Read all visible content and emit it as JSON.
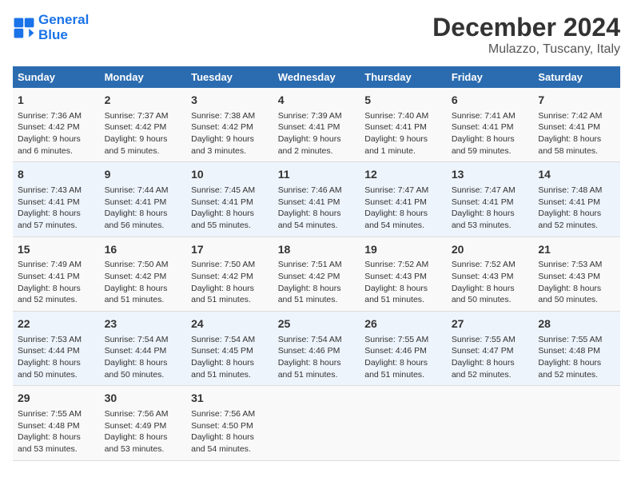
{
  "logo": {
    "line1": "General",
    "line2": "Blue"
  },
  "title": "December 2024",
  "subtitle": "Mulazzo, Tuscany, Italy",
  "headers": [
    "Sunday",
    "Monday",
    "Tuesday",
    "Wednesday",
    "Thursday",
    "Friday",
    "Saturday"
  ],
  "weeks": [
    [
      {
        "day": "1",
        "info": "Sunrise: 7:36 AM\nSunset: 4:42 PM\nDaylight: 9 hours\nand 6 minutes."
      },
      {
        "day": "2",
        "info": "Sunrise: 7:37 AM\nSunset: 4:42 PM\nDaylight: 9 hours\nand 5 minutes."
      },
      {
        "day": "3",
        "info": "Sunrise: 7:38 AM\nSunset: 4:42 PM\nDaylight: 9 hours\nand 3 minutes."
      },
      {
        "day": "4",
        "info": "Sunrise: 7:39 AM\nSunset: 4:41 PM\nDaylight: 9 hours\nand 2 minutes."
      },
      {
        "day": "5",
        "info": "Sunrise: 7:40 AM\nSunset: 4:41 PM\nDaylight: 9 hours\nand 1 minute."
      },
      {
        "day": "6",
        "info": "Sunrise: 7:41 AM\nSunset: 4:41 PM\nDaylight: 8 hours\nand 59 minutes."
      },
      {
        "day": "7",
        "info": "Sunrise: 7:42 AM\nSunset: 4:41 PM\nDaylight: 8 hours\nand 58 minutes."
      }
    ],
    [
      {
        "day": "8",
        "info": "Sunrise: 7:43 AM\nSunset: 4:41 PM\nDaylight: 8 hours\nand 57 minutes."
      },
      {
        "day": "9",
        "info": "Sunrise: 7:44 AM\nSunset: 4:41 PM\nDaylight: 8 hours\nand 56 minutes."
      },
      {
        "day": "10",
        "info": "Sunrise: 7:45 AM\nSunset: 4:41 PM\nDaylight: 8 hours\nand 55 minutes."
      },
      {
        "day": "11",
        "info": "Sunrise: 7:46 AM\nSunset: 4:41 PM\nDaylight: 8 hours\nand 54 minutes."
      },
      {
        "day": "12",
        "info": "Sunrise: 7:47 AM\nSunset: 4:41 PM\nDaylight: 8 hours\nand 54 minutes."
      },
      {
        "day": "13",
        "info": "Sunrise: 7:47 AM\nSunset: 4:41 PM\nDaylight: 8 hours\nand 53 minutes."
      },
      {
        "day": "14",
        "info": "Sunrise: 7:48 AM\nSunset: 4:41 PM\nDaylight: 8 hours\nand 52 minutes."
      }
    ],
    [
      {
        "day": "15",
        "info": "Sunrise: 7:49 AM\nSunset: 4:41 PM\nDaylight: 8 hours\nand 52 minutes."
      },
      {
        "day": "16",
        "info": "Sunrise: 7:50 AM\nSunset: 4:42 PM\nDaylight: 8 hours\nand 51 minutes."
      },
      {
        "day": "17",
        "info": "Sunrise: 7:50 AM\nSunset: 4:42 PM\nDaylight: 8 hours\nand 51 minutes."
      },
      {
        "day": "18",
        "info": "Sunrise: 7:51 AM\nSunset: 4:42 PM\nDaylight: 8 hours\nand 51 minutes."
      },
      {
        "day": "19",
        "info": "Sunrise: 7:52 AM\nSunset: 4:43 PM\nDaylight: 8 hours\nand 51 minutes."
      },
      {
        "day": "20",
        "info": "Sunrise: 7:52 AM\nSunset: 4:43 PM\nDaylight: 8 hours\nand 50 minutes."
      },
      {
        "day": "21",
        "info": "Sunrise: 7:53 AM\nSunset: 4:43 PM\nDaylight: 8 hours\nand 50 minutes."
      }
    ],
    [
      {
        "day": "22",
        "info": "Sunrise: 7:53 AM\nSunset: 4:44 PM\nDaylight: 8 hours\nand 50 minutes."
      },
      {
        "day": "23",
        "info": "Sunrise: 7:54 AM\nSunset: 4:44 PM\nDaylight: 8 hours\nand 50 minutes."
      },
      {
        "day": "24",
        "info": "Sunrise: 7:54 AM\nSunset: 4:45 PM\nDaylight: 8 hours\nand 51 minutes."
      },
      {
        "day": "25",
        "info": "Sunrise: 7:54 AM\nSunset: 4:46 PM\nDaylight: 8 hours\nand 51 minutes."
      },
      {
        "day": "26",
        "info": "Sunrise: 7:55 AM\nSunset: 4:46 PM\nDaylight: 8 hours\nand 51 minutes."
      },
      {
        "day": "27",
        "info": "Sunrise: 7:55 AM\nSunset: 4:47 PM\nDaylight: 8 hours\nand 52 minutes."
      },
      {
        "day": "28",
        "info": "Sunrise: 7:55 AM\nSunset: 4:48 PM\nDaylight: 8 hours\nand 52 minutes."
      }
    ],
    [
      {
        "day": "29",
        "info": "Sunrise: 7:55 AM\nSunset: 4:48 PM\nDaylight: 8 hours\nand 53 minutes."
      },
      {
        "day": "30",
        "info": "Sunrise: 7:56 AM\nSunset: 4:49 PM\nDaylight: 8 hours\nand 53 minutes."
      },
      {
        "day": "31",
        "info": "Sunrise: 7:56 AM\nSunset: 4:50 PM\nDaylight: 8 hours\nand 54 minutes."
      },
      {
        "day": "",
        "info": ""
      },
      {
        "day": "",
        "info": ""
      },
      {
        "day": "",
        "info": ""
      },
      {
        "day": "",
        "info": ""
      }
    ]
  ]
}
